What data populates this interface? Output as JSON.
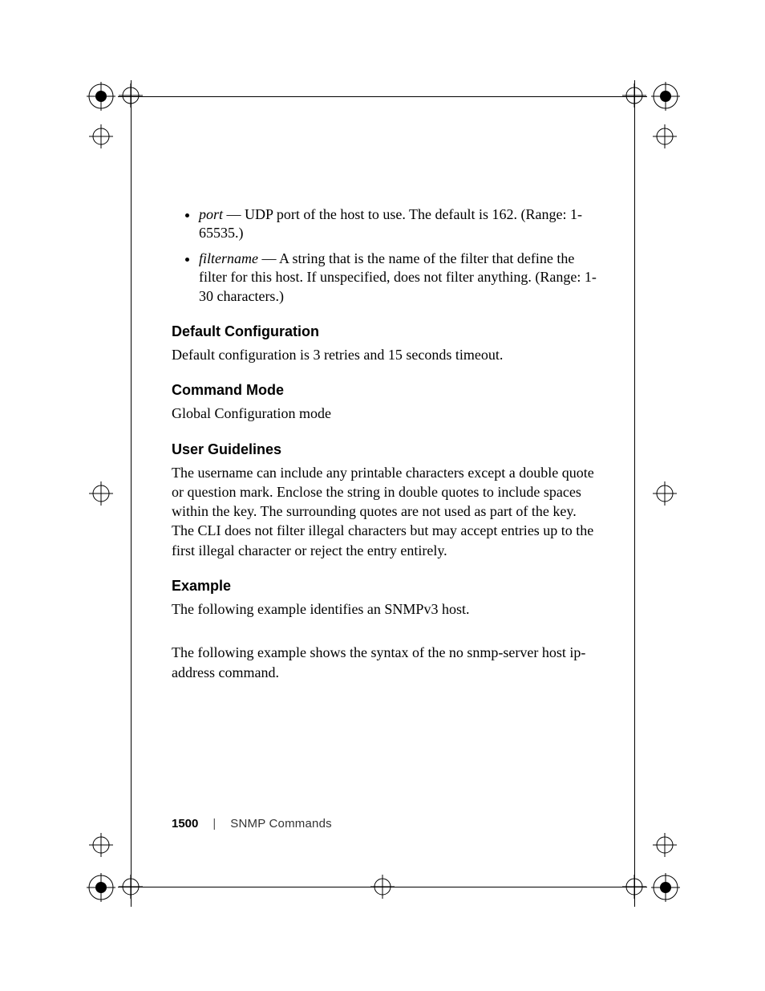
{
  "bullets": [
    {
      "term": "port",
      "rest": " — UDP port of the host to use. The default is 162. (Range: 1-65535.)"
    },
    {
      "term": "filtername",
      "rest": " — A string that is the name of the filter that define the filter for this host. If unspecified, does not filter anything. (Range: 1-30 characters.)"
    }
  ],
  "sections": {
    "defcfg": {
      "h": "Default Configuration",
      "p": "Default configuration is 3 retries and 15 seconds timeout."
    },
    "cmdmode": {
      "h": "Command Mode",
      "p": "Global Configuration mode"
    },
    "ug": {
      "h": "User Guidelines",
      "p": "The username can include any printable characters except a double quote or question mark. Enclose the string in double quotes to include spaces within the key. The surrounding quotes are not used as part of the key. The CLI does not filter illegal characters but may accept entries up to the first illegal character or reject the entry entirely."
    },
    "ex": {
      "h": "Example",
      "p1": "The following example identifies an SNMPv3 host.",
      "p2": "The following example shows the syntax of the no snmp-server host ip-address command."
    }
  },
  "footer": {
    "page": "1500",
    "sep": "|",
    "section": "SNMP Commands"
  }
}
